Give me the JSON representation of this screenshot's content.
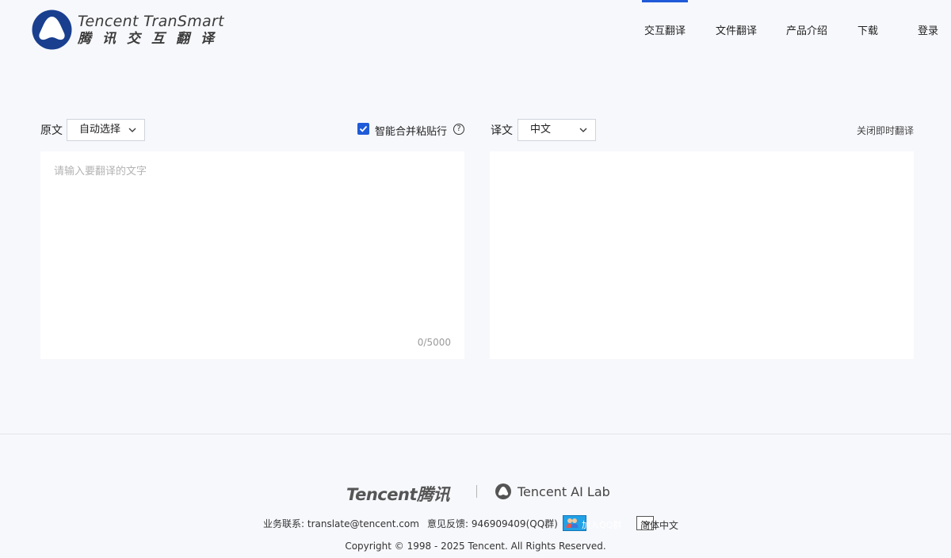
{
  "header": {
    "logo_en": "Tencent TranSmart",
    "logo_cn": "腾讯交互翻译",
    "nav": [
      {
        "label": "交互翻译",
        "active": true
      },
      {
        "label": "文件翻译",
        "active": false
      },
      {
        "label": "产品介绍",
        "active": false
      },
      {
        "label": "下载",
        "active": false
      },
      {
        "label": "登录",
        "active": false
      }
    ]
  },
  "toolbar": {
    "source_label": "原文",
    "source_lang": "自动选择",
    "smart_merge_label": "智能合并粘贴行",
    "smart_merge_checked": true,
    "help_icon": "?",
    "target_label": "译文",
    "target_lang": "中文",
    "close_instant": "关闭即时翻译"
  },
  "source_panel": {
    "placeholder": "请输入要翻译的文字",
    "value": "",
    "counter": "0/5000"
  },
  "target_panel": {
    "value": ""
  },
  "footer": {
    "tencent_logo": "Tencent腾讯",
    "ailab": "Tencent AI Lab",
    "business_contact": "业务联系: translate@tencent.com",
    "feedback": "意见反馈: 946909409(QQ群)",
    "qq_button": "加入QQ群",
    "lang_select": "简体中文",
    "copyright": "Copyright © 1998 - 2025 Tencent. All Rights Reserved."
  },
  "colors": {
    "accent": "#1f5ad8",
    "logo_blue": "#1a3f8f",
    "qq_blue": "#21a1e6",
    "background": "#f7f8fc"
  }
}
